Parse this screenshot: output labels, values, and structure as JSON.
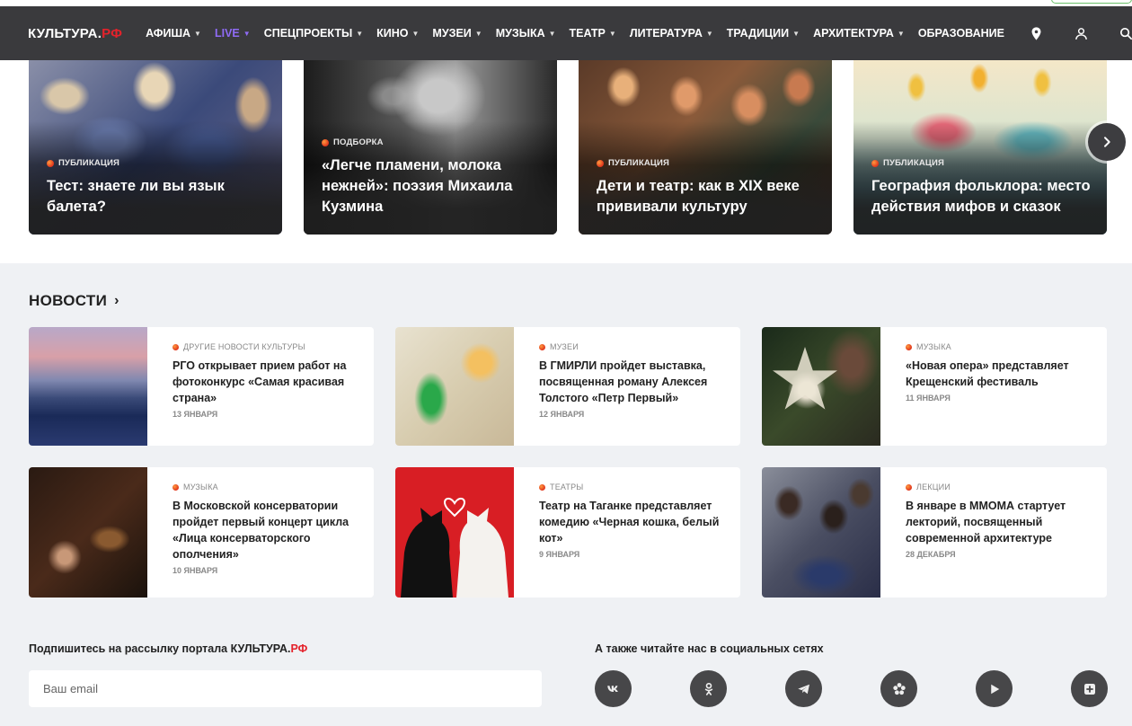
{
  "header": {
    "logo_main": "КУЛЬТУРА.",
    "logo_accent": "РФ",
    "nav": [
      {
        "label": "АФИША",
        "caret": true
      },
      {
        "label": "LIVE",
        "caret": true,
        "live": true
      },
      {
        "label": "СПЕЦПРОЕКТЫ",
        "caret": true
      },
      {
        "label": "КИНО",
        "caret": true
      },
      {
        "label": "МУЗЕИ",
        "caret": true
      },
      {
        "label": "МУЗЫКА",
        "caret": true
      },
      {
        "label": "ТЕАТР",
        "caret": true
      },
      {
        "label": "ЛИТЕРАТУРА",
        "caret": true
      },
      {
        "label": "ТРАДИЦИИ",
        "caret": true
      },
      {
        "label": "АРХИТЕКТУРА",
        "caret": true
      },
      {
        "label": "ОБРАЗОВАНИЕ",
        "caret": false
      }
    ],
    "icons": [
      "location-pin-icon",
      "user-icon",
      "search-icon"
    ]
  },
  "featured": [
    {
      "category": "ПУБЛИКАЦИЯ",
      "title": "Тест: знаете ли вы язык балета?"
    },
    {
      "category": "ПОДБОРКА",
      "title": "«Легче пламени, молока нежней»: поэзия Михаила Кузмина"
    },
    {
      "category": "ПУБЛИКАЦИЯ",
      "title": "Дети и театр: как в XIX веке прививали культуру"
    },
    {
      "category": "ПУБЛИКАЦИЯ",
      "title": "География фольклора: место действия мифов и сказок"
    }
  ],
  "news": {
    "heading": "НОВОСТИ",
    "items": [
      {
        "category": "ДРУГИЕ НОВОСТИ КУЛЬТУРЫ",
        "title": "РГО открывает прием работ на фотоконкурс «Самая красивая страна»",
        "date": "13 ЯНВАРЯ"
      },
      {
        "category": "МУЗЕИ",
        "title": "В ГМИРЛИ пройдет выставка, посвященная роману Алексея Толстого «Петр Первый»",
        "date": "12 ЯНВАРЯ"
      },
      {
        "category": "МУЗЫКА",
        "title": "«Новая опера» представляет Крещенский фестиваль",
        "date": "11 ЯНВАРЯ"
      },
      {
        "category": "МУЗЫКА",
        "title": "В Московской консерватории пройдет первый концерт цикла «Лица консерваторского ополчения»",
        "date": "10 ЯНВАРЯ"
      },
      {
        "category": "ТЕАТРЫ",
        "title": "Театр на Таганке представляет комедию «Черная кошка, белый кот»",
        "date": "9 ЯНВАРЯ"
      },
      {
        "category": "ЛЕКЦИИ",
        "title": "В январе в ММОМА стартует лекторий, посвященный современной архитектуре",
        "date": "28 ДЕКАБРЯ"
      }
    ]
  },
  "footer": {
    "subscribe_label": "Подпишитесь на рассылку портала КУЛЬТУРА.",
    "subscribe_accent": "РФ",
    "email_placeholder": "Ваш email",
    "social_label": "А также читайте нас в социальных сетях",
    "socials": [
      {
        "icon": "vk-icon",
        "text": "vk"
      },
      {
        "icon": "odnoklassniki-icon"
      },
      {
        "icon": "telegram-icon"
      },
      {
        "icon": "flower-icon"
      },
      {
        "icon": "play-icon"
      },
      {
        "icon": "plus-square-icon"
      }
    ]
  },
  "colors": {
    "accent": "#e4222b",
    "nav_bg": "#3a3a3d",
    "live": "#8f6bf5",
    "page_bg": "#eff1f4"
  }
}
